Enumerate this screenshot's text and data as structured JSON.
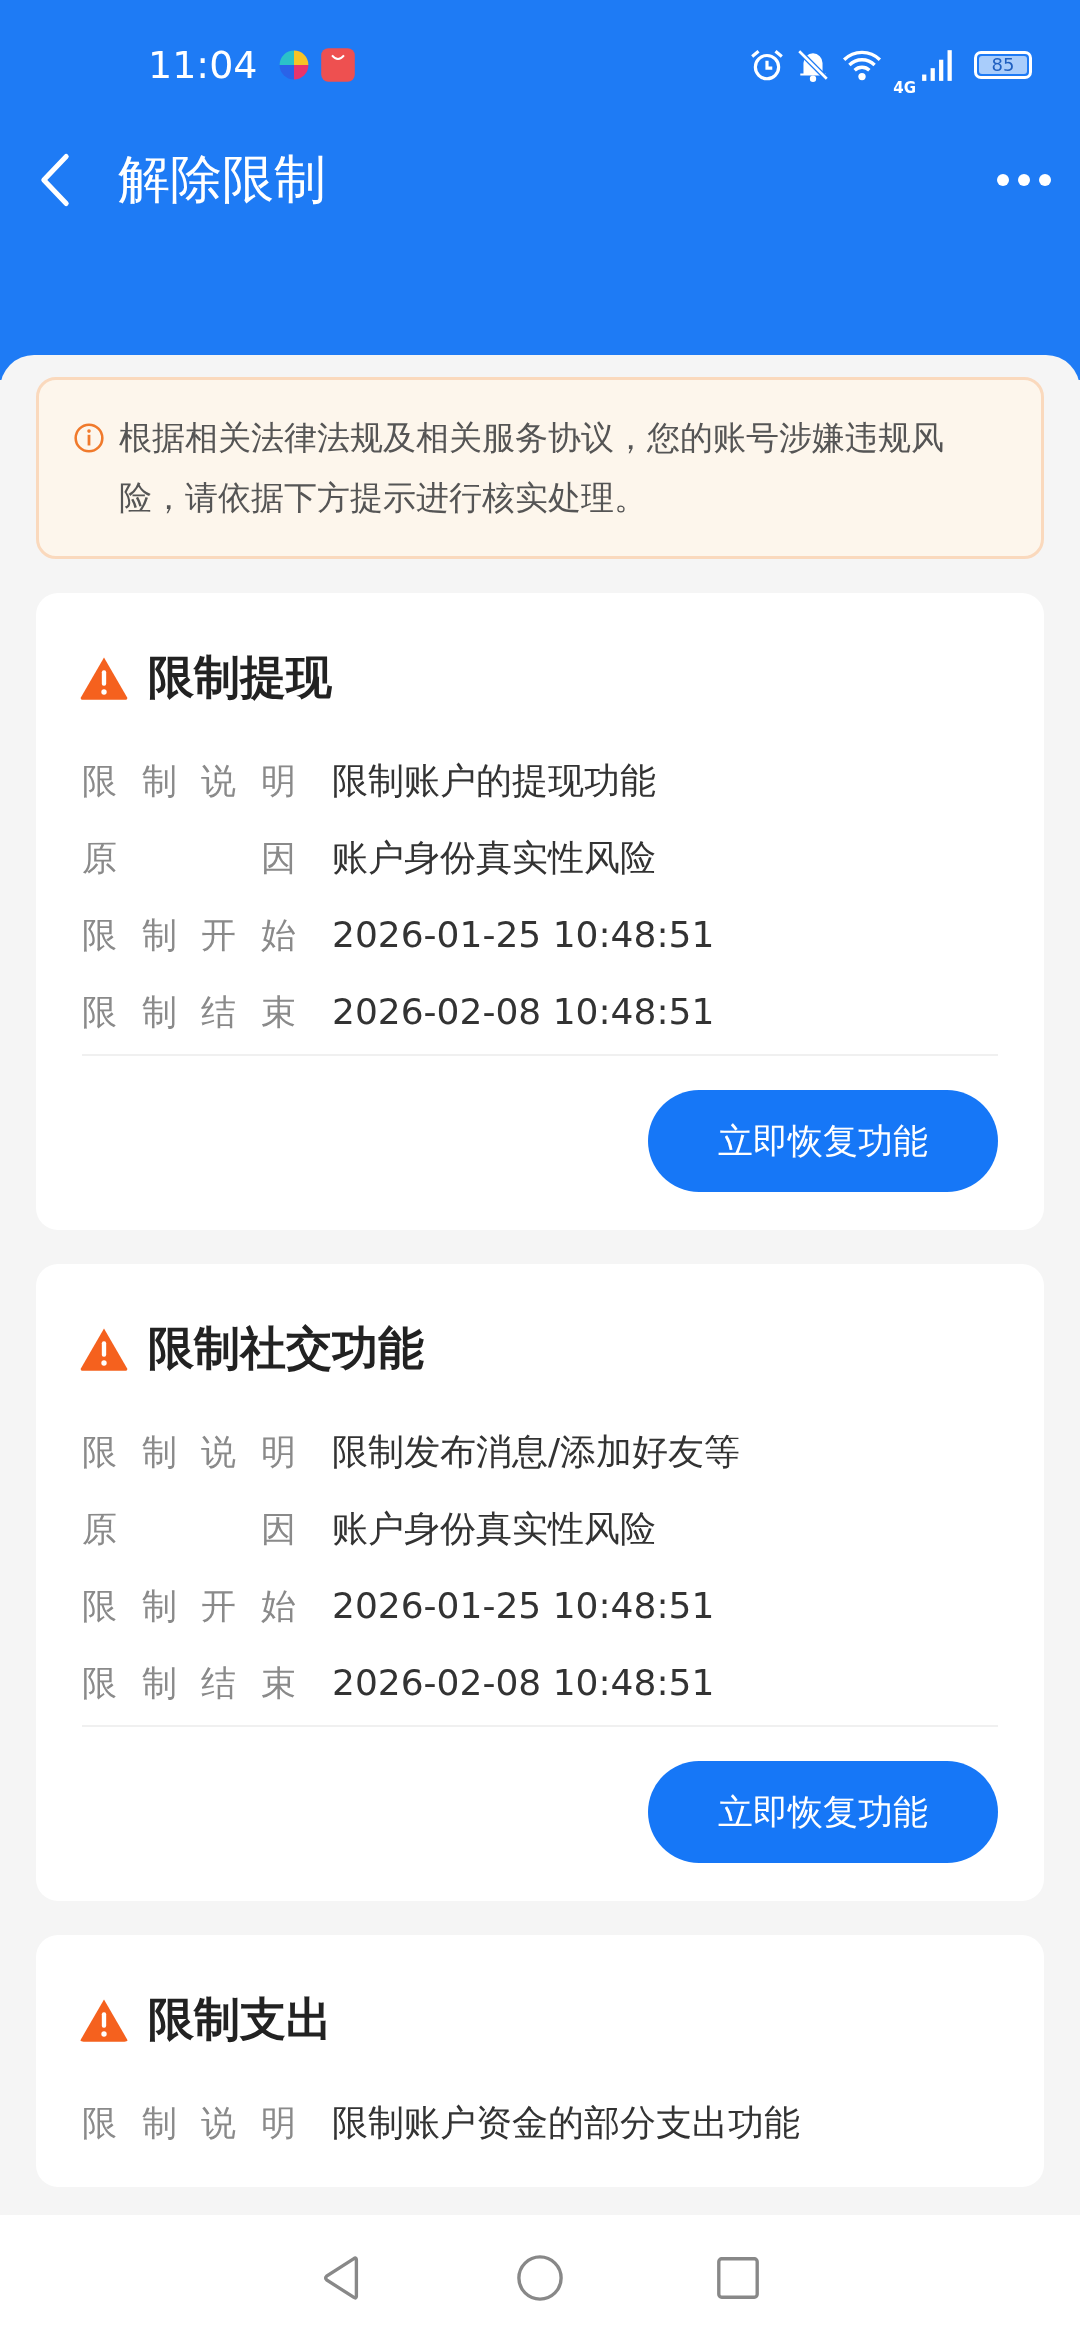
{
  "status_bar": {
    "time": "11:04",
    "network": "4G",
    "battery": "85"
  },
  "header": {
    "title": "解除限制"
  },
  "notice": {
    "text": "根据相关法律法规及相关服务协议，您的账号涉嫌违规风险，请依据下方提示进行核实处理。"
  },
  "restrictions": [
    {
      "title": "限制提现",
      "rows": [
        {
          "label": "限制说明",
          "value": "限制账户的提现功能"
        },
        {
          "label": "原因",
          "value": "账户身份真实性风险"
        },
        {
          "label": "限制开始",
          "value": "2026-01-25 10:48:51"
        },
        {
          "label": "限制结束",
          "value": "2026-02-08 10:48:51"
        }
      ],
      "button": "立即恢复功能"
    },
    {
      "title": "限制社交功能",
      "rows": [
        {
          "label": "限制说明",
          "value": "限制发布消息/添加好友等"
        },
        {
          "label": "原因",
          "value": "账户身份真实性风险"
        },
        {
          "label": "限制开始",
          "value": "2026-01-25 10:48:51"
        },
        {
          "label": "限制结束",
          "value": "2026-02-08 10:48:51"
        }
      ],
      "button": "立即恢复功能"
    },
    {
      "title": "限制支出",
      "rows": [
        {
          "label": "限制说明",
          "value": "限制账户资金的部分支出功能"
        }
      ]
    }
  ]
}
